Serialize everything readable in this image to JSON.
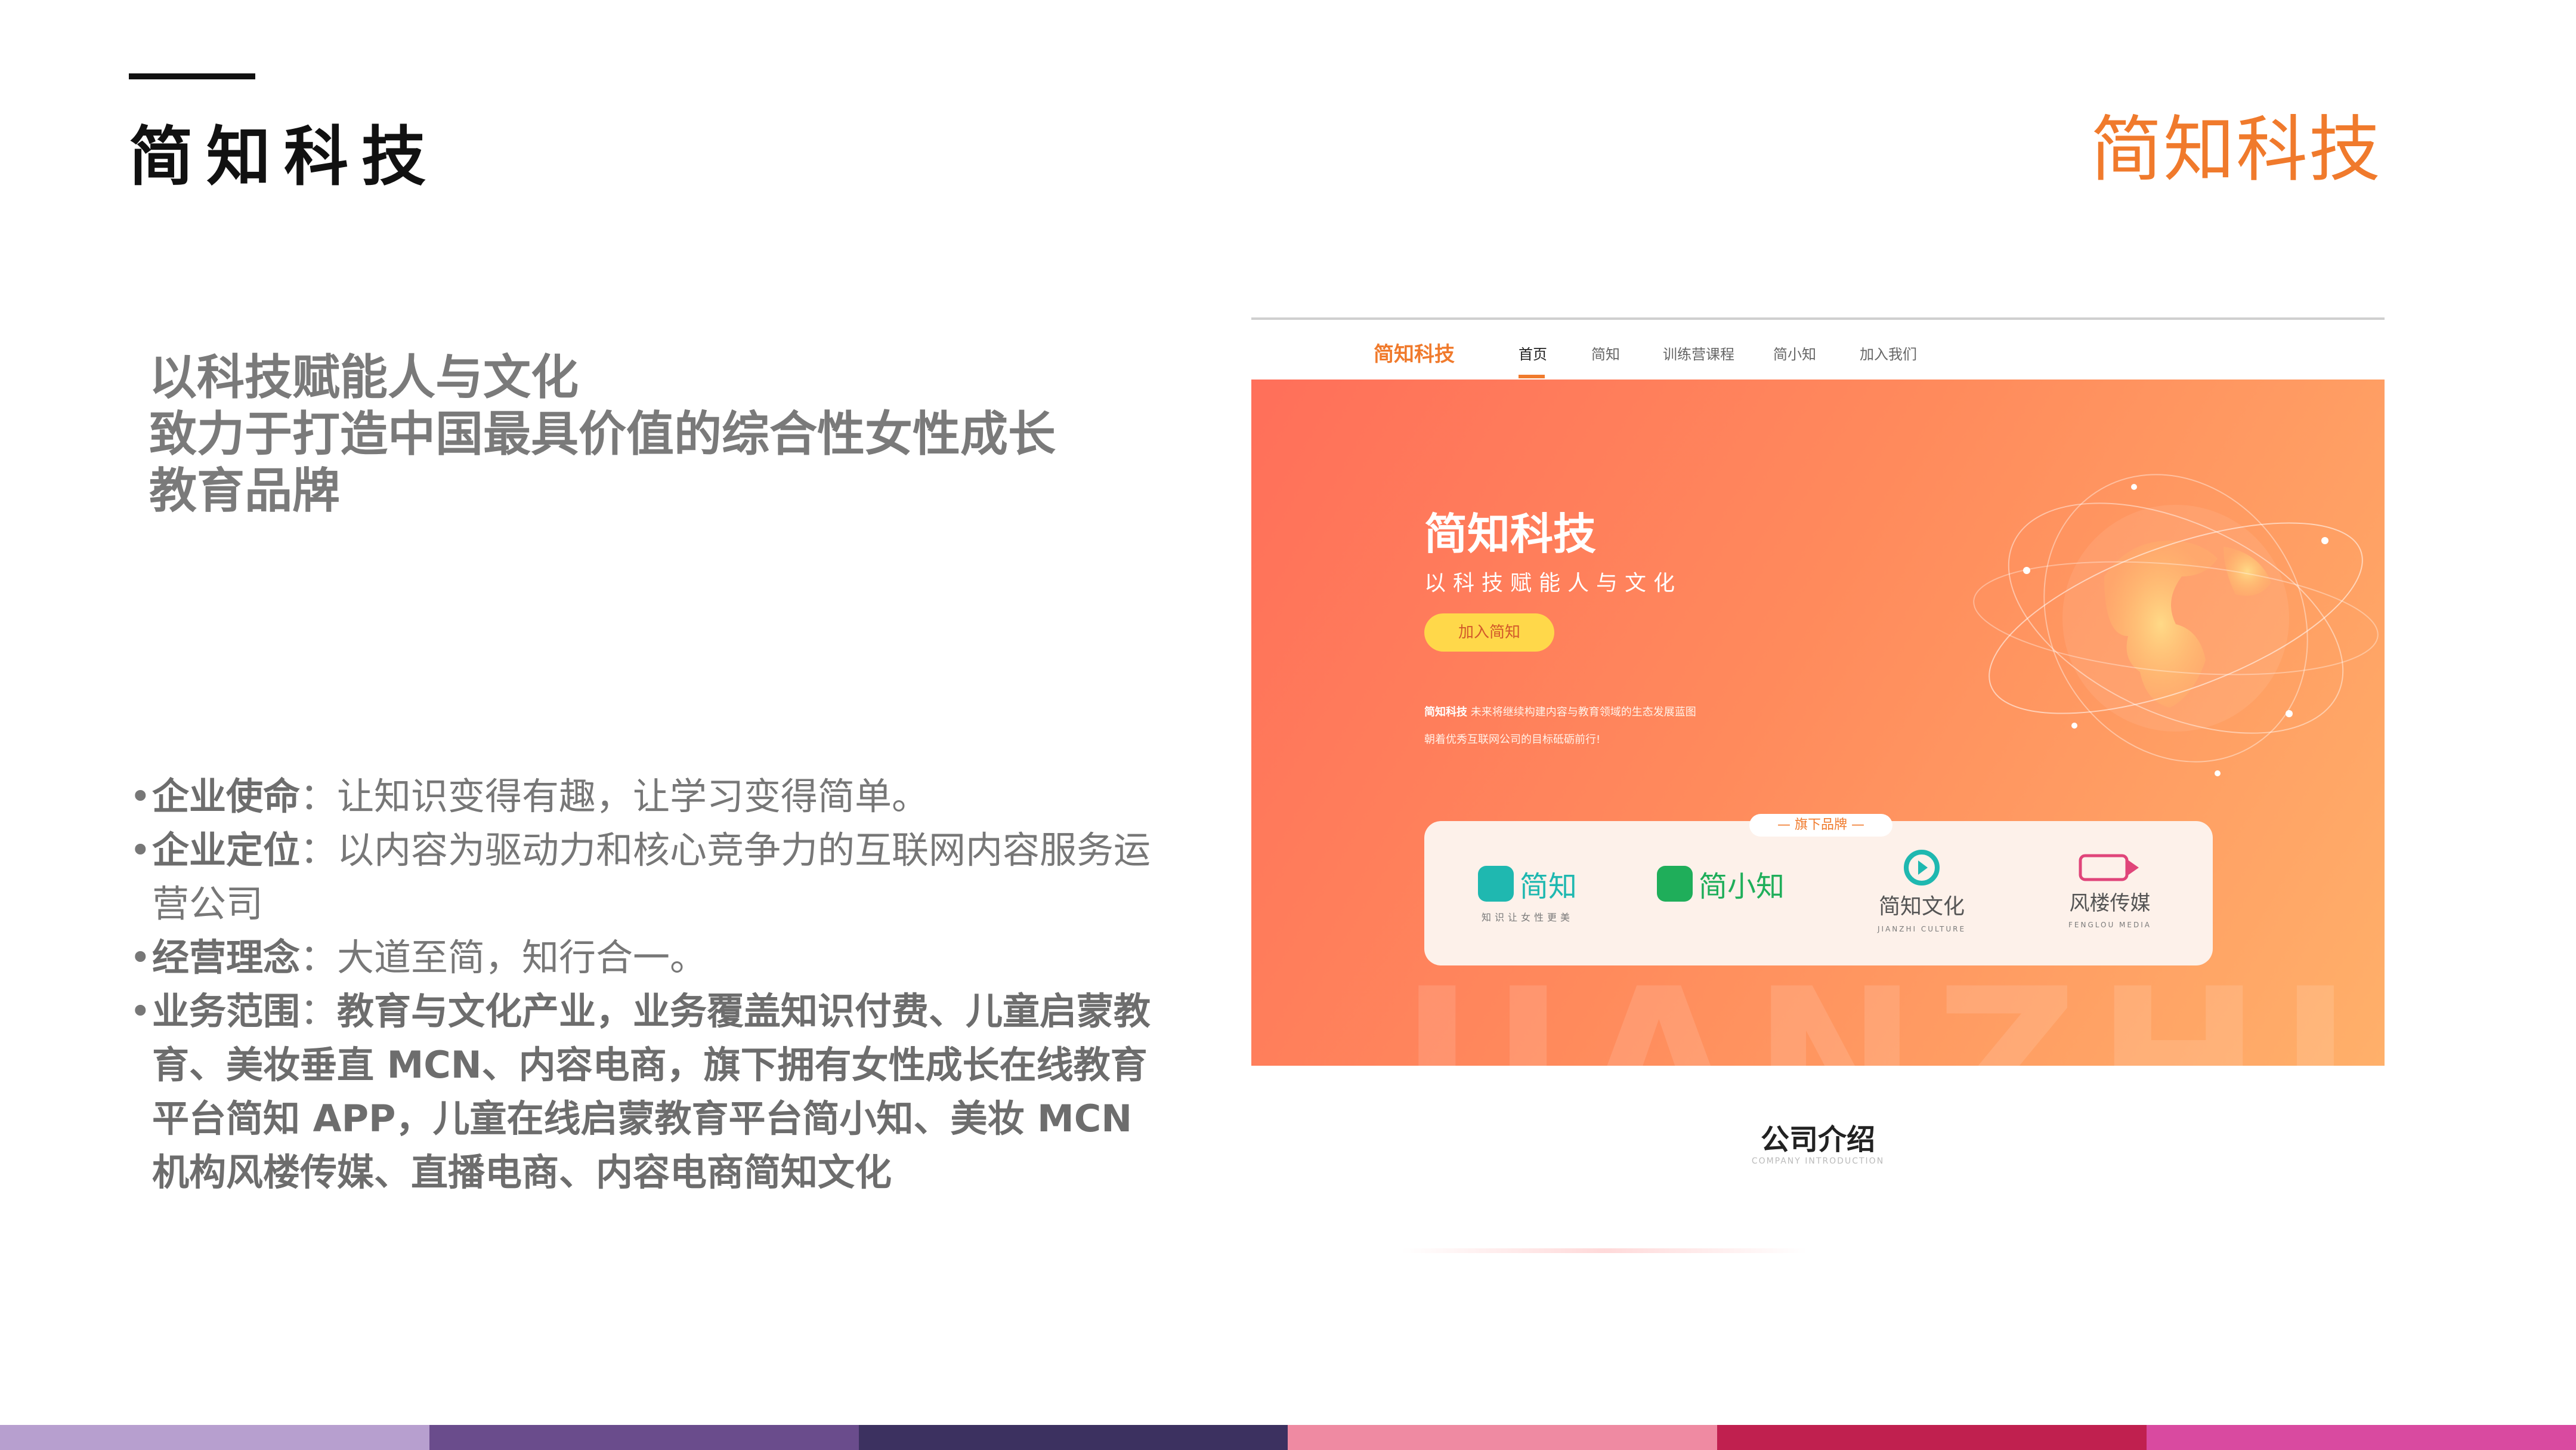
{
  "slide": {
    "title": "简知科技",
    "logo_text": "简知科技",
    "headline": [
      "以科技赋能人与文化",
      "致力于打造中国最具价值的综合性女性成长",
      "教育品牌"
    ],
    "bullets": [
      {
        "bullet": "•",
        "key": "企业使命",
        "sep": "：",
        "value": "让知识变得有趣，让学习变得简单。",
        "bold": false
      },
      {
        "bullet": "•",
        "key": "企业定位",
        "sep": "：",
        "value": "以内容为驱动力和核心竞争力的互联网内容服务运营公司",
        "bold": false
      },
      {
        "bullet": "•",
        "key": "经营理念",
        "sep": "：",
        "value": "大道至简，知行合一。",
        "bold": false
      },
      {
        "bullet": "•",
        "key": "业务范围",
        "sep": "：",
        "value": "教育与文化产业，业务覆盖知识付费、儿童启蒙教育、美妆垂直 MCN、内容电商，旗下拥有女性成长在线教育平台简知 APP，儿童在线启蒙教育平台简小知、美妆 MCN 机构风楼传媒、直播电商、内容电商简知文化",
        "bold": true
      }
    ],
    "colors": {
      "accent": "#f07a2c",
      "bar": [
        "#b79fcf",
        "#6a4c8c",
        "#3c3160",
        "#ef8aa2",
        "#c0204f",
        "#d94aa0"
      ]
    }
  },
  "website": {
    "logo": "简知科技",
    "nav": [
      "首页",
      "简知",
      "训练营课程",
      "简小知",
      "加入我们"
    ],
    "hero": {
      "title": "简知科技",
      "subtitle": "以科技赋能人与文化",
      "button": "加入简知",
      "desc_bold": "简知科技",
      "desc_line1": " 未来将继续构建内容与教育领域的生态发展蓝图",
      "desc_line2": "朝着优秀互联网公司的目标砥砺前行!",
      "watermark": "JIANZHI"
    },
    "brands_tag": "— 旗下品牌 —",
    "brands": [
      {
        "name": "简知",
        "caption": "知识让女性更美",
        "icon": "jianzhi-app-icon",
        "color": "#1fb8b0"
      },
      {
        "name": "简小知",
        "caption": "",
        "icon": "jianxiaozhi-app-icon",
        "color": "#1fae5a"
      },
      {
        "name": "简知文化",
        "caption": "JIANZHI CULTURE",
        "icon": "jianzhi-culture-icon",
        "color": "#1fb8b0"
      },
      {
        "name": "风楼传媒",
        "caption": "FENGLOU MEDIA",
        "icon": "fenglou-media-icon",
        "color": "#e0457a"
      }
    ],
    "intro_title": "公司介绍",
    "intro_sub": "COMPANY INTRODUCTION"
  }
}
